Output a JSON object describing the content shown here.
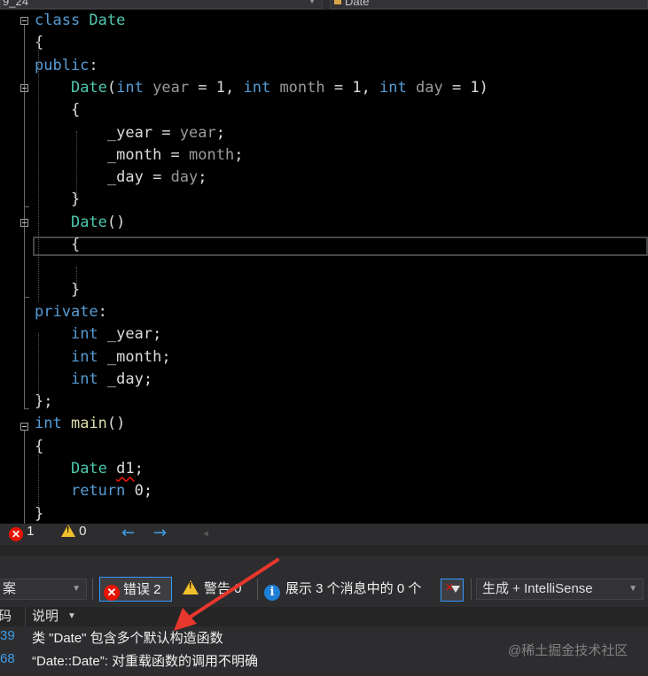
{
  "top_bar": {
    "scope_combo": "9_24",
    "member_combo": "Date"
  },
  "code": {
    "lines": [
      [
        [
          "kw",
          "class "
        ],
        [
          "ty",
          "Date"
        ]
      ],
      [
        [
          "pu",
          "{"
        ]
      ],
      [
        [
          "kw",
          "public"
        ],
        [
          "pu",
          ":"
        ]
      ],
      [
        [
          "pu",
          "    "
        ],
        [
          "ty",
          "Date"
        ],
        [
          "pu",
          "("
        ],
        [
          "kw",
          "int"
        ],
        [
          "pa",
          " year"
        ],
        [
          "pu",
          " = 1, "
        ],
        [
          "kw",
          "int"
        ],
        [
          "pa",
          " month"
        ],
        [
          "pu",
          " = 1, "
        ],
        [
          "kw",
          "int"
        ],
        [
          "pa",
          " day"
        ],
        [
          "pu",
          " = 1)"
        ]
      ],
      [
        [
          "pu",
          "    {"
        ]
      ],
      [
        [
          "pu",
          "        "
        ],
        [
          "va",
          "_year"
        ],
        [
          "pu",
          " = "
        ],
        [
          "pa",
          "year"
        ],
        [
          "pu",
          ";"
        ]
      ],
      [
        [
          "pu",
          "        "
        ],
        [
          "va",
          "_month"
        ],
        [
          "pu",
          " = "
        ],
        [
          "pa",
          "month"
        ],
        [
          "pu",
          ";"
        ]
      ],
      [
        [
          "pu",
          "        "
        ],
        [
          "va",
          "_day"
        ],
        [
          "pu",
          " = "
        ],
        [
          "pa",
          "day"
        ],
        [
          "pu",
          ";"
        ]
      ],
      [
        [
          "pu",
          "    }"
        ]
      ],
      [
        [
          "pu",
          "    "
        ],
        [
          "ty",
          "Date"
        ],
        [
          "pu",
          "()"
        ]
      ],
      [
        [
          "pu",
          "    {"
        ]
      ],
      [
        [
          "pu",
          ""
        ]
      ],
      [
        [
          "pu",
          "    }"
        ]
      ],
      [
        [
          "kw",
          "private"
        ],
        [
          "pu",
          ":"
        ]
      ],
      [
        [
          "pu",
          "    "
        ],
        [
          "kw",
          "int"
        ],
        [
          "va",
          " _year"
        ],
        [
          "pu",
          ";"
        ]
      ],
      [
        [
          "pu",
          "    "
        ],
        [
          "kw",
          "int"
        ],
        [
          "va",
          " _month"
        ],
        [
          "pu",
          ";"
        ]
      ],
      [
        [
          "pu",
          "    "
        ],
        [
          "kw",
          "int"
        ],
        [
          "va",
          " _day"
        ],
        [
          "pu",
          ";"
        ]
      ],
      [
        [
          "pu",
          "};"
        ]
      ],
      [
        [
          "kw",
          "int"
        ],
        [
          "pu",
          " "
        ],
        [
          "fn",
          "main"
        ],
        [
          "pu",
          "()"
        ]
      ],
      [
        [
          "pu",
          "{"
        ]
      ],
      [
        [
          "pu",
          "    "
        ],
        [
          "ty",
          "Date"
        ],
        [
          "pu",
          " "
        ],
        [
          "sq",
          "d1"
        ],
        [
          "pu",
          ";"
        ]
      ],
      [
        [
          "pu",
          "    "
        ],
        [
          "kw",
          "return"
        ],
        [
          "pu",
          " 0;"
        ]
      ],
      [
        [
          "pu",
          "}"
        ]
      ]
    ]
  },
  "status_bar": {
    "error_count": "1",
    "warning_count": "0",
    "back_arrow": "←",
    "forward_arrow": "→",
    "scroll_left": "◀"
  },
  "error_list": {
    "scope_combo": "案",
    "errors_button": "错误 2",
    "warnings_button": "警告 0",
    "messages_button": "展示 3 个消息中的 0 个",
    "build_combo": "生成 + IntelliSense",
    "col_code_header": "码",
    "col_desc_header": "说明",
    "rows": [
      {
        "code": "39",
        "description": "类 \"Date\" 包含多个默认构造函数"
      },
      {
        "code": "68",
        "description": "“Date::Date”: 对重载函数的调用不明确"
      }
    ]
  },
  "watermark": "@稀土掘金技术社区",
  "colors": {
    "keyword": "#569cd6",
    "type": "#4ec9b0",
    "function": "#dcdcaa",
    "error": "#e51400",
    "warning": "#f2c02c",
    "annotation_arrow": "#e8372c"
  }
}
